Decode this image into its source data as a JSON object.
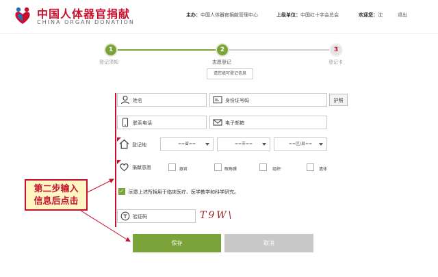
{
  "header": {
    "logo_cn": "中国人体器官捐献",
    "logo_en": "CHINA ORGAN DONATION",
    "sponsor_label": "主办：",
    "sponsor_value": "中国人体器官捐献管理中心",
    "superior_label": "上级单位：",
    "superior_value": "中国红十字会总会",
    "welcome_label": "欢迎您：",
    "welcome_name": "沈",
    "logout": "退出"
  },
  "steps": [
    {
      "number": "1",
      "label": "登记须知",
      "state": "done"
    },
    {
      "number": "2",
      "label": "志愿登记",
      "state": "current"
    },
    {
      "number": "3",
      "label": "登记卡",
      "state": "todo"
    }
  ],
  "hint": "请您填写登记信息",
  "form": {
    "name_label": "姓名",
    "id_label": "身份证号码",
    "passport_button": "护照",
    "phone_label": "联系电话",
    "email_label": "电子邮箱",
    "region_label": "登记地",
    "province": "==省==",
    "city": "==市==",
    "district": "==区/县==",
    "donation_label": "捐献意愿",
    "options": [
      "器官",
      "眼角膜",
      "组织",
      "遗体"
    ],
    "agree_text": "同意上述所捐用于临床医疗、医学教学和科学研究。",
    "captcha_label": "验证码",
    "captcha_text": "T9W\\"
  },
  "buttons": {
    "save": "保存",
    "cancel": "取消"
  },
  "annotation": {
    "line1": "第二步输入",
    "line2": "信息后点击"
  },
  "colors": {
    "brand_red": "#c8102e",
    "accent_green": "#7aa33a",
    "disabled_gray": "#c8c8c8"
  }
}
